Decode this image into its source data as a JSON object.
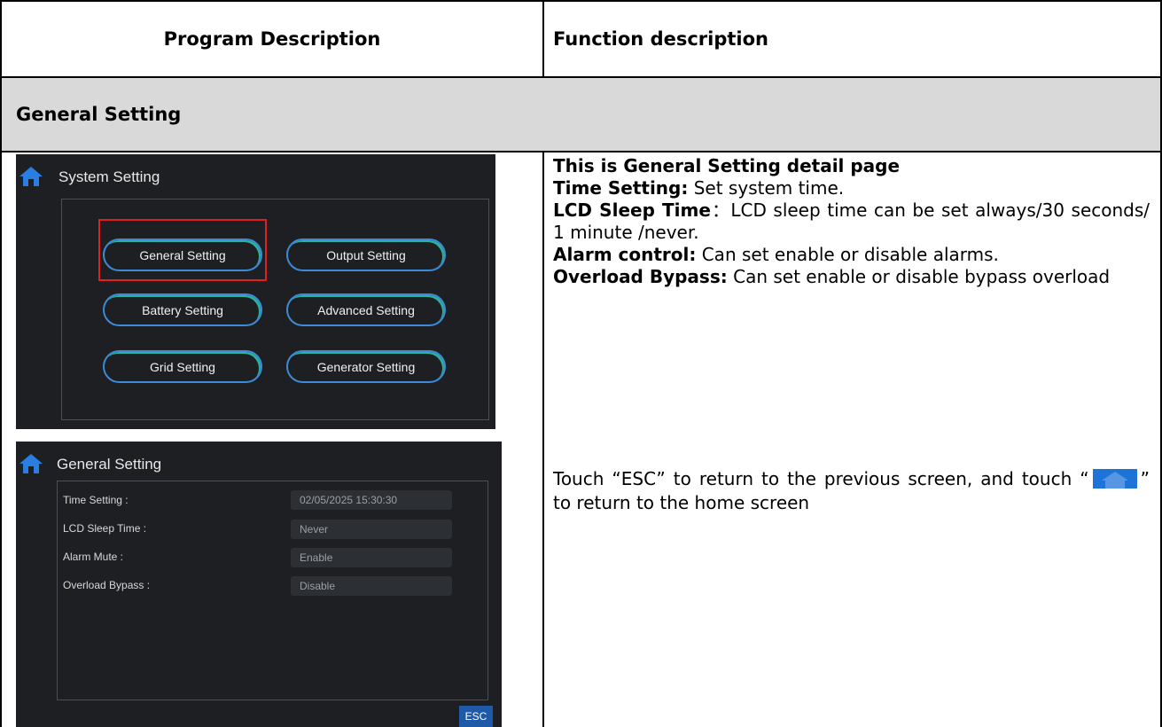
{
  "table": {
    "col1_header": "Program Description",
    "col2_header": "Function description",
    "section_title": "General Setting"
  },
  "system_setting_screen": {
    "title": "System Setting",
    "buttons": [
      {
        "label": "General Setting",
        "selected": true
      },
      {
        "label": "Output Setting"
      },
      {
        "label": "Battery Setting"
      },
      {
        "label": "Advanced Setting"
      },
      {
        "label": "Grid Setting"
      },
      {
        "label": "Generator Setting"
      }
    ]
  },
  "general_setting_screen": {
    "title": "General Setting",
    "rows": [
      {
        "label": "Time Setting :",
        "value": "02/05/2025  15:30:30"
      },
      {
        "label": "LCD Sleep Time :",
        "value": "Never"
      },
      {
        "label": "Alarm Mute :",
        "value": "Enable"
      },
      {
        "label": "Overload Bypass :",
        "value": "Disable"
      }
    ],
    "esc_label": "ESC"
  },
  "description_1": {
    "heading": "This is General Setting detail page",
    "time_label": "Time Setting:",
    "time_text": " Set system time.",
    "lcd_label": "LCD Sleep Time",
    "lcd_text": "：LCD sleep time can be set always/30 seconds/ 1 minute /never.",
    "alarm_label": "Alarm control:",
    "alarm_text": " Can set enable or disable alarms.",
    "overload_label": "Overload Bypass:",
    "overload_text": " Can set enable or disable bypass overload"
  },
  "description_2": {
    "text_before": "Touch “ESC” to return to the previous screen, and touch “",
    "text_after": "” to return to the home screen"
  },
  "colors": {
    "accent_blue": "#1e73d8",
    "button_border": "#3d8bd6",
    "button_teal": "#2bb39a",
    "selection_red": "#e02020",
    "section_gray": "#d9d9d9"
  }
}
